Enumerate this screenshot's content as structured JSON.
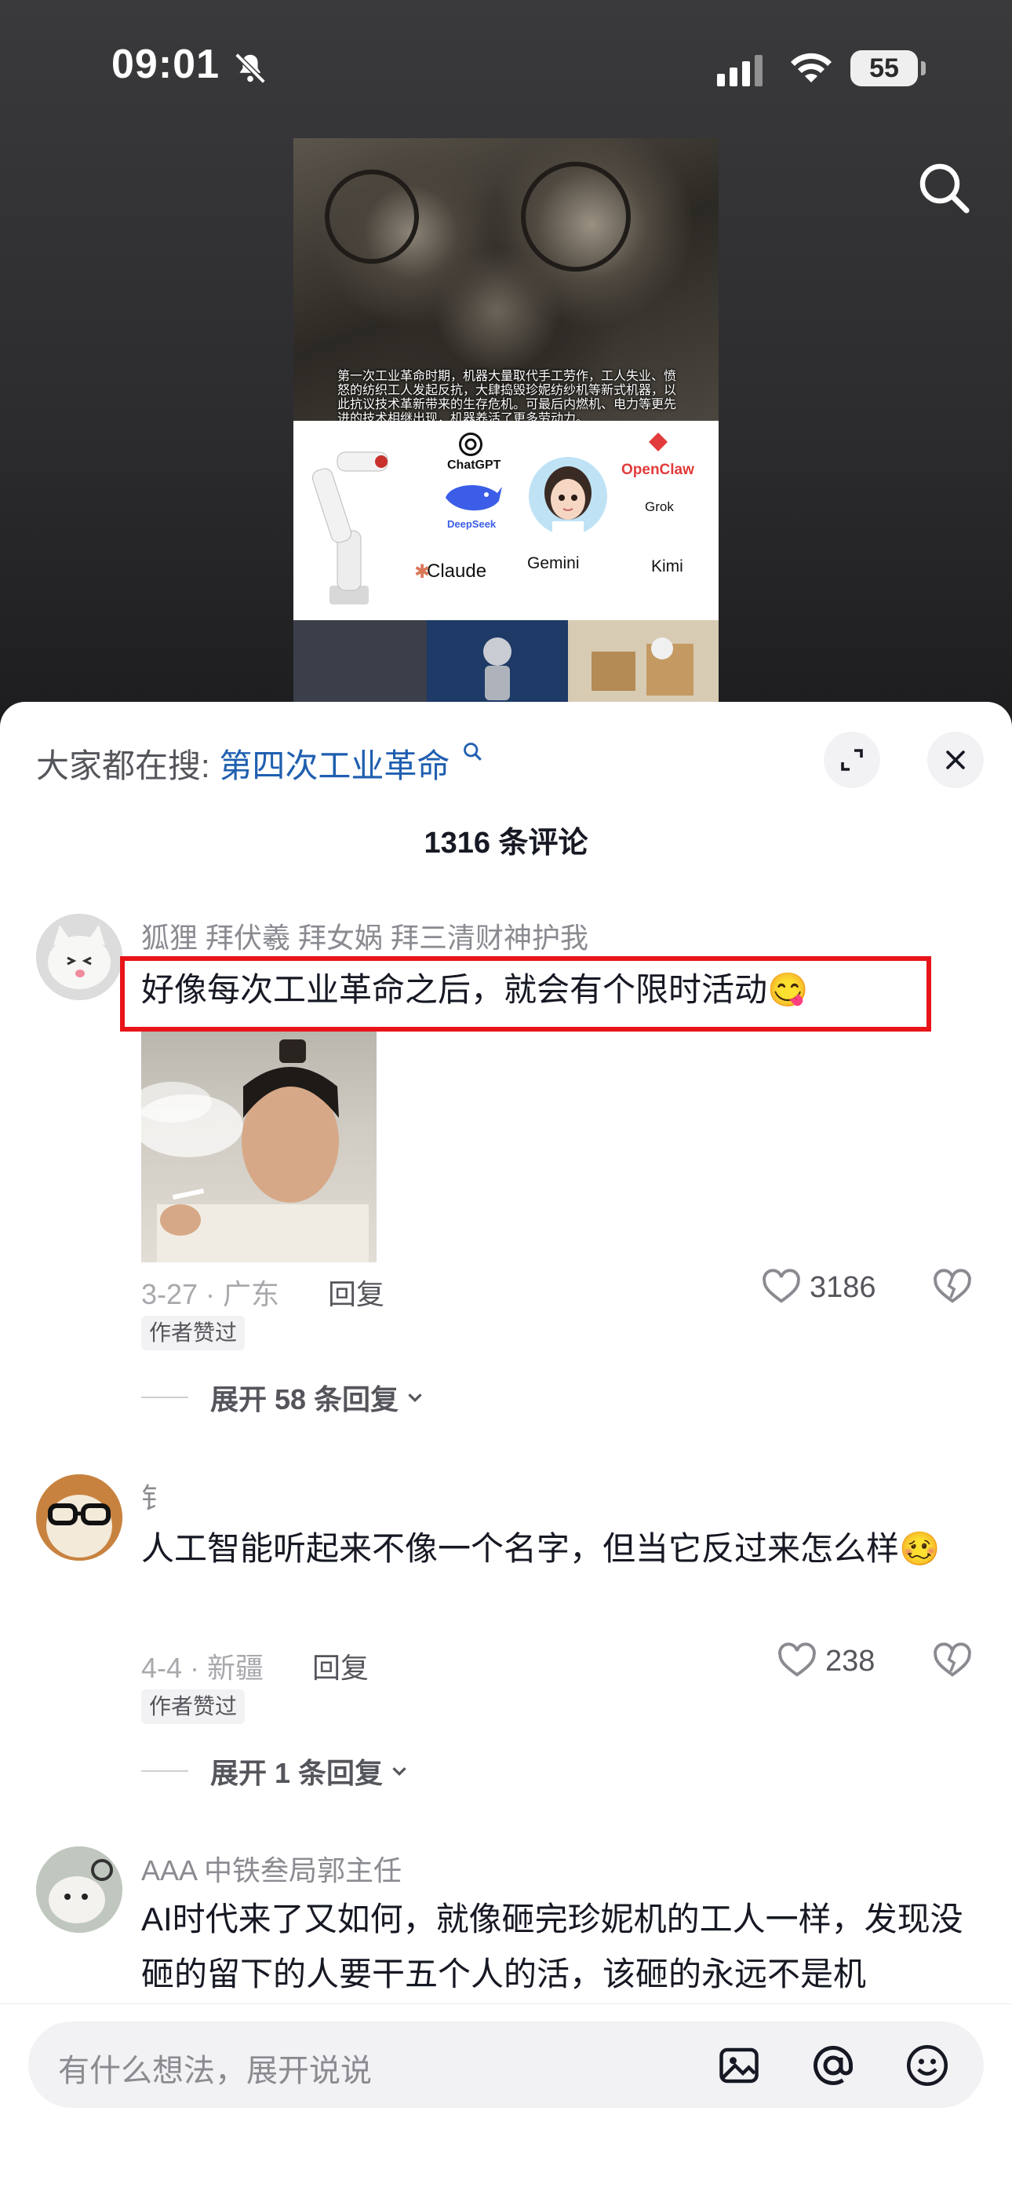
{
  "status_bar": {
    "time": "09:01",
    "battery": "55"
  },
  "poster": {
    "caption": "第一次工业革命时期，机器大量取代手工劳作，工人失业、愤怒的纺织工人发起反抗，大肆捣毁珍妮纺纱机等新式机器，以此抗议技术革新带来的生存危机。可最后内燃机、电力等更先进的技术相继出现，机器养活了更多劳动力。",
    "logos": [
      "ChatGPT",
      "DeepSeek",
      "Claude",
      "OpenClaw",
      "Grok",
      "Gemini",
      "Kimi"
    ]
  },
  "panel": {
    "hot_search_prefix": "大家都在搜:",
    "hot_search_keyword": "第四次工业革命",
    "comment_count": "1316 条评论"
  },
  "comments": [
    {
      "username": "狐狸 拜伏羲 拜女娲 拜三清财神护我",
      "text": "好像每次工业革命之后，就会有个限时活动😋",
      "meta": "3-27 · 广东",
      "reply_label": "回复",
      "likes": "3186",
      "badge": "作者赞过",
      "expand": "展开 58 条回复"
    },
    {
      "username": "钅",
      "text": "人工智能听起来不像一个名字，但当它反过来怎么样🥴",
      "meta": "4-4 · 新疆",
      "reply_label": "回复",
      "likes": "238",
      "badge": "作者赞过",
      "expand": "展开 1 条回复"
    },
    {
      "username": "AAA 中铁叁局郭主任",
      "text": "AI时代来了又如何，就像砸完珍妮机的工人一样，发现没砸的留下的人要干五个人的活，该砸的永远不是机"
    }
  ],
  "input": {
    "placeholder": "有什么想法，展开说说"
  },
  "colors": {
    "accent_link": "#1f5fb0",
    "highlight_box": "#e8141a"
  }
}
